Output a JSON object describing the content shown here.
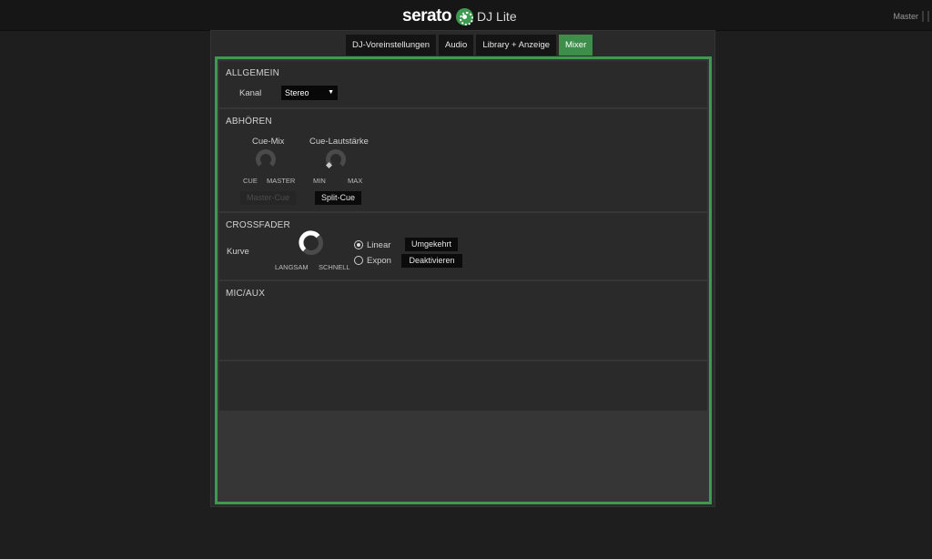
{
  "app": {
    "brand": "serato",
    "product": "DJ Lite",
    "master": "Master",
    "accent": "#3d9a4e"
  },
  "tabs": [
    {
      "label": "DJ-Voreinstellungen",
      "active": false
    },
    {
      "label": "Audio",
      "active": false
    },
    {
      "label": "Library + Anzeige",
      "active": false
    },
    {
      "label": "Mixer",
      "active": true
    }
  ],
  "allgemein": {
    "title": "ALLGEMEIN",
    "kanal_label": "Kanal",
    "kanal_value": "Stereo"
  },
  "abhoeren": {
    "title": "ABHÖREN",
    "cue_mix": {
      "label": "Cue-Mix",
      "min": "CUE",
      "max": "MASTER"
    },
    "cue_volume": {
      "label": "Cue-Lautstärke",
      "min": "MIN",
      "max": "MAX"
    },
    "master_cue": "Master-Cue",
    "split_cue": "Split-Cue"
  },
  "crossfader": {
    "title": "CROSSFADER",
    "kurve_label": "Kurve",
    "slow": "LANGSAM",
    "fast": "SCHNELL",
    "linear": "Linear",
    "expon": "Expon",
    "selected": "Linear",
    "reverse": "Umgekehrt",
    "disable": "Deaktivieren"
  },
  "mic_aux": {
    "title": "MIC/AUX"
  }
}
